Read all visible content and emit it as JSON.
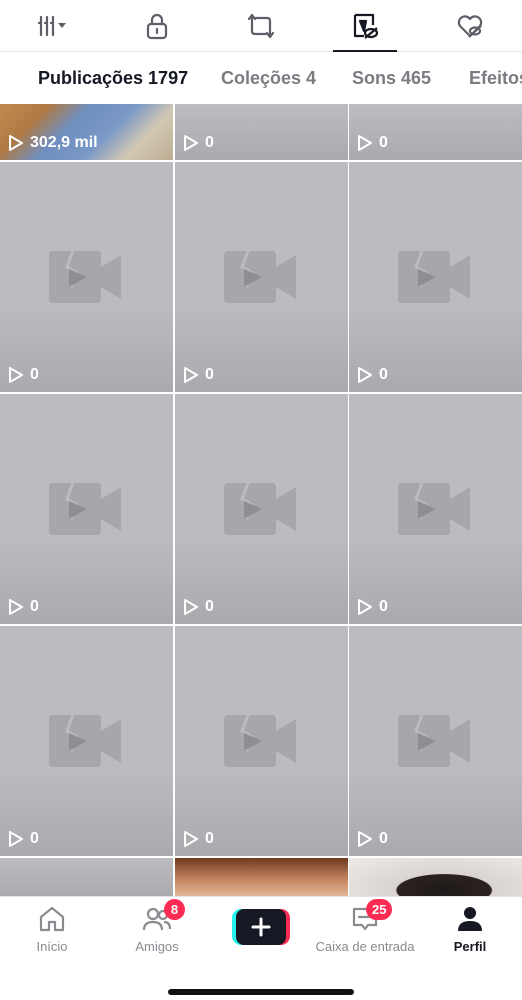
{
  "icon_tabs": [
    {
      "icon": "grid-dropdown-icon",
      "active": false
    },
    {
      "icon": "lock-icon",
      "active": false
    },
    {
      "icon": "repost-icon",
      "active": false
    },
    {
      "icon": "tagged-icon",
      "active": true
    },
    {
      "icon": "liked-heart-icon",
      "active": false
    }
  ],
  "text_tabs": [
    {
      "label": "Publicações 1797",
      "active": true
    },
    {
      "label": "Coleções 4",
      "active": false
    },
    {
      "label": "Sons 465",
      "active": false
    },
    {
      "label": "Efeitos",
      "active": false
    }
  ],
  "grid": {
    "row0": [
      "302,9 mil",
      "0",
      "0"
    ],
    "row1": [
      "0",
      "0",
      "0"
    ],
    "row2": [
      "0",
      "0",
      "0"
    ],
    "row3": [
      "0",
      "0",
      "0"
    ]
  },
  "bottom_nav": {
    "home": "Início",
    "friends": "Amigos",
    "friends_badge": "8",
    "inbox": "Caixa de entrada",
    "inbox_badge": "25",
    "profile": "Perfil"
  },
  "colors": {
    "accent": "#fe2c55",
    "cyan": "#25f4ee",
    "text": "#161823"
  }
}
